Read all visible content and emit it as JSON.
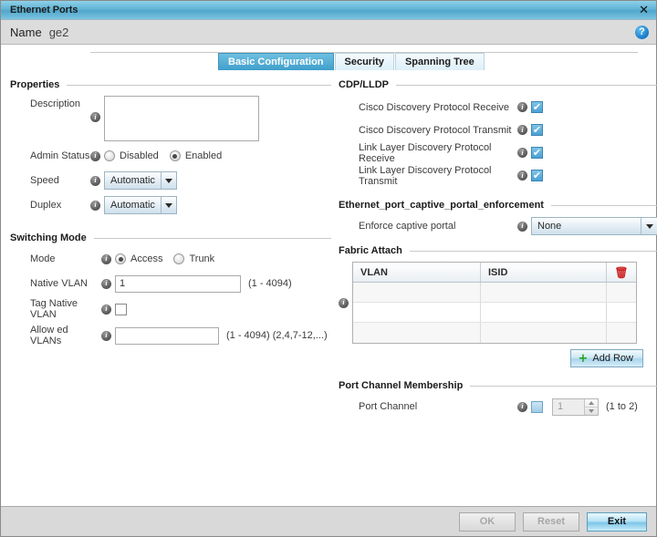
{
  "window": {
    "title": "Ethernet Ports",
    "close_label": "✕",
    "name_label": "Name",
    "name_value": "ge2",
    "help_label": "?"
  },
  "tabs": [
    {
      "label": "Basic Configuration",
      "active": true
    },
    {
      "label": "Security",
      "active": false
    },
    {
      "label": "Spanning Tree",
      "active": false
    }
  ],
  "properties": {
    "section_title": "Properties",
    "description_label": "Description",
    "description_value": "",
    "admin_status_label": "Admin Status",
    "admin_disabled_label": "Disabled",
    "admin_enabled_label": "Enabled",
    "admin_selected": "Enabled",
    "speed_label": "Speed",
    "speed_value": "Automatic",
    "duplex_label": "Duplex",
    "duplex_value": "Automatic"
  },
  "switching_mode": {
    "section_title": "Switching Mode",
    "mode_label": "Mode",
    "mode_access_label": "Access",
    "mode_trunk_label": "Trunk",
    "mode_selected": "Access",
    "native_vlan_label": "Native VLAN",
    "native_vlan_value": "1",
    "native_vlan_hint": "(1 - 4094)",
    "tag_native_vlan_label": "Tag Native VLAN",
    "tag_native_vlan_checked": false,
    "allowed_vlans_label": "Allow ed VLANs",
    "allowed_vlans_value": "",
    "allowed_vlans_hint": "(1 - 4094)  (2,4,7-12,...)"
  },
  "cdp_lldp": {
    "section_title": "CDP/LLDP",
    "items": [
      {
        "label": "Cisco Discovery Protocol Receive",
        "checked": true
      },
      {
        "label": "Cisco Discovery Protocol Transmit",
        "checked": true
      },
      {
        "label": "Link Layer Discovery Protocol Receive",
        "checked": true
      },
      {
        "label": "Link Layer Discovery Protocol Transmit",
        "checked": true
      }
    ]
  },
  "captive_portal": {
    "section_title": "Ethernet_port_captive_portal_enforcement",
    "enforce_label": "Enforce captive portal",
    "enforce_value": "None"
  },
  "fabric_attach": {
    "section_title": "Fabric Attach",
    "columns": [
      "VLAN",
      "ISID"
    ],
    "delete_icon": "🗑",
    "rows": [
      {
        "vlan": "",
        "isid": ""
      },
      {
        "vlan": "",
        "isid": ""
      },
      {
        "vlan": "",
        "isid": ""
      }
    ],
    "add_row_label": "Add Row",
    "add_row_plus": "+"
  },
  "port_channel": {
    "section_title": "Port Channel Membership",
    "label": "Port Channel",
    "checked": false,
    "value": "1",
    "hint": "(1 to 2)"
  },
  "footer": {
    "ok_label": "OK",
    "reset_label": "Reset",
    "exit_label": "Exit"
  }
}
